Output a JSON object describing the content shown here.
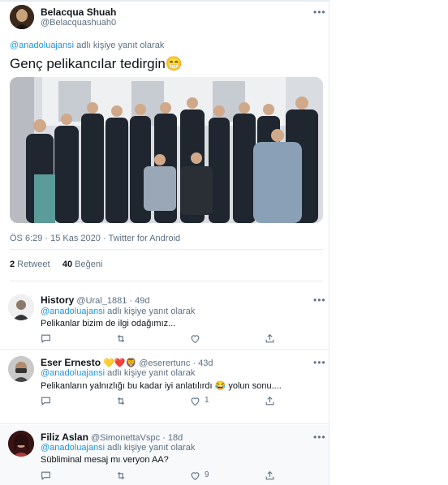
{
  "main": {
    "author_name": "Belacqua Shuah",
    "author_handle": "@Belacquashuah0",
    "more_icon": "more-icon",
    "reply_handle": "@anadoluajansi",
    "reply_suffix": " adlı kişiye yanıt olarak",
    "text": "Genç pelikancılar tedirgin😁",
    "timestamp": "ÖS 6:29 · 15 Kas 2020 · Twitter for Android",
    "retweet_count": "2",
    "retweet_label": " Retweet",
    "like_count": "40",
    "like_label": " Beğeni"
  },
  "replies": [
    {
      "name": "History",
      "handle": "@Ural_1881",
      "time": "· 49d",
      "reply_handle": "@anadoluajansi",
      "reply_suffix": " adlı kişiye yanıt olarak",
      "text": "Pelikanlar bizim de ilgi odağımız...",
      "reply_count": "",
      "retweet_count": "",
      "like_count": ""
    },
    {
      "name": "Eser Ernesto",
      "emojis": "💛❤️🦁",
      "handle": "@eserertunc",
      "time": "· 43d",
      "reply_handle": "@anadoluajansi",
      "reply_suffix": " adlı kişiye yanıt olarak",
      "text": "Pelikanların yalnızlığı bu kadar iyi anlatılırdı 😂 yolun sonu....",
      "reply_count": "",
      "retweet_count": "",
      "like_count": "1"
    },
    {
      "name": "Filiz Aslan",
      "handle": "@SimonettaVspc",
      "time": "· 18d",
      "reply_handle": "@anadoluajansi",
      "reply_suffix": " adlı kişiye yanıt olarak",
      "text": "Sübliminal mesaj mı veryon AA?",
      "reply_count": "",
      "retweet_count": "",
      "like_count": "9"
    }
  ],
  "colors": {
    "link": "#1b95e0",
    "muted": "#5b7083",
    "border": "#e6ecf0",
    "text": "#0f1419"
  }
}
